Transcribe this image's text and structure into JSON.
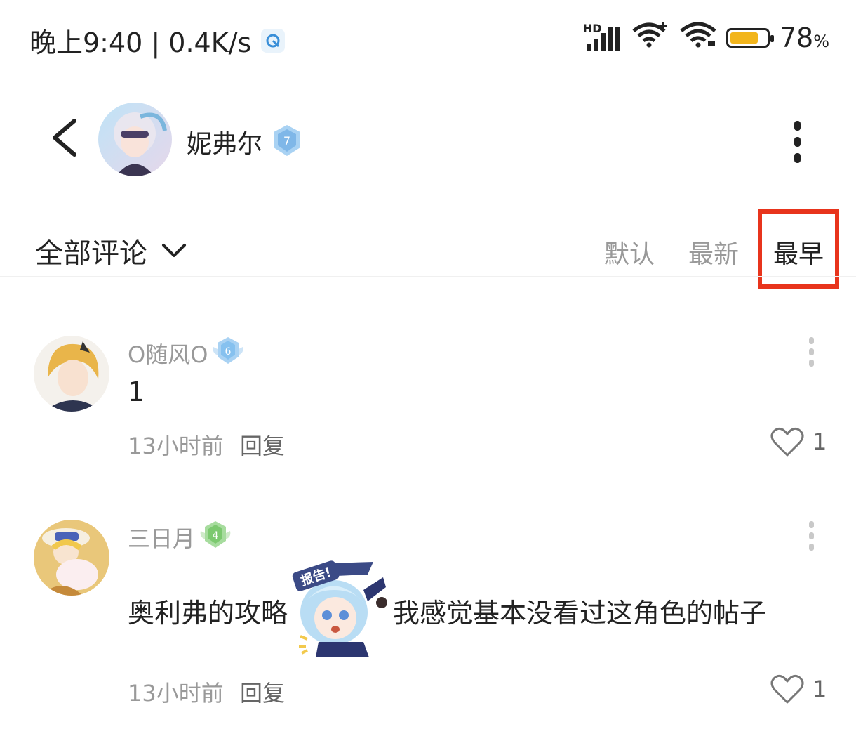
{
  "status_bar": {
    "time_speed": "晚上9:40 | 0.4K/s",
    "network": "HD",
    "battery_level": 0.78,
    "battery_text": "78",
    "battery_unit": "%"
  },
  "header": {
    "title": "妮弗尔",
    "level": "7"
  },
  "filter": {
    "label": "全部评论",
    "sort_options": [
      "默认",
      "最新",
      "最早"
    ],
    "active_sort": "最早"
  },
  "comments": [
    {
      "name": "O随风O",
      "level": "6",
      "text": "1",
      "time": "13小时前",
      "reply": "回复",
      "likes": "1"
    },
    {
      "name": "三日月",
      "level": "4",
      "text_before": "奥利弗的攻略",
      "sticker_text": "报告!",
      "text_after": "我感觉基本没看过这角色的帖子",
      "time": "13小时前",
      "reply": "回复",
      "likes": "1"
    }
  ],
  "colors": {
    "highlight": "#e8341c",
    "level_blue": "#8cc3ef",
    "level_green": "#86d07c",
    "battery": "#f2b51c"
  }
}
